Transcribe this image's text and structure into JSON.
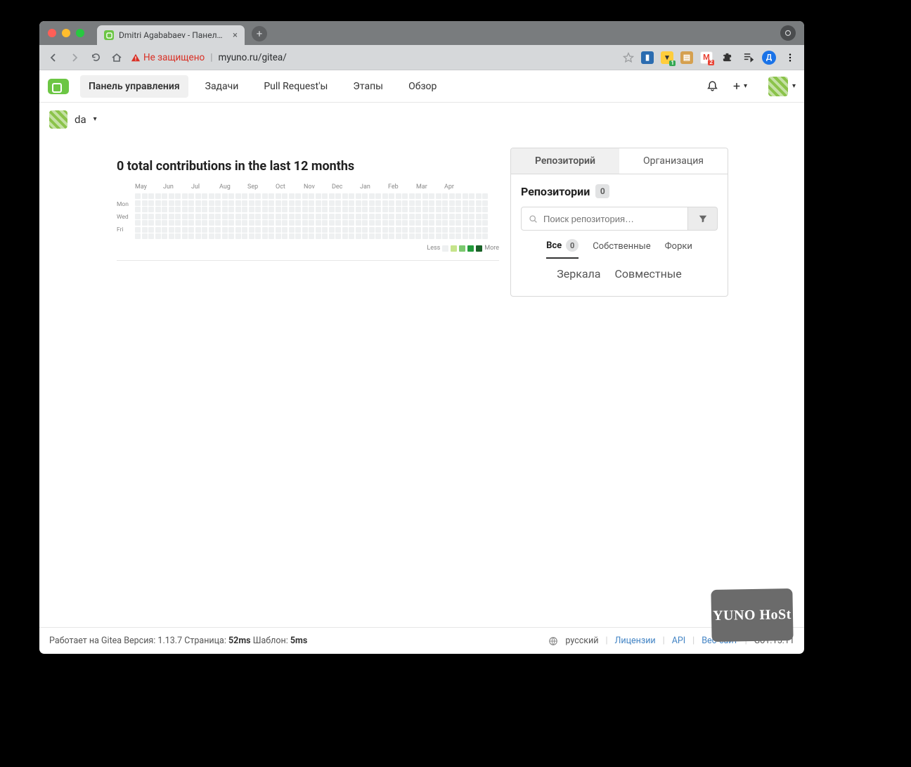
{
  "browser": {
    "tab_title": "Dmitri Agababaev - Панель уп",
    "not_secure_label": "Не защищено",
    "url": "myuno.ru/gitea/",
    "traffic_colors": {
      "close": "#ff5f57",
      "min": "#ffbd2e",
      "max": "#28c840"
    },
    "ext_badges": {
      "green": "1",
      "red": "2"
    },
    "profile_letter": "Д"
  },
  "nav": {
    "tabs": [
      "Панель управления",
      "Задачи",
      "Pull Request'ы",
      "Этапы",
      "Обзор"
    ],
    "active_index": 0
  },
  "context": {
    "username": "da"
  },
  "contributions": {
    "title": "0 total contributions in the last 12 months",
    "months": [
      "May",
      "Jun",
      "Jul",
      "Aug",
      "Sep",
      "Oct",
      "Nov",
      "Dec",
      "Jan",
      "Feb",
      "Mar",
      "Apr"
    ],
    "days": [
      "Mon",
      "Wed",
      "Fri"
    ],
    "legend": {
      "less": "Less",
      "more": "More",
      "colors": [
        "#eef0f1",
        "#c6e48b",
        "#7bc96f",
        "#239a3b",
        "#196127"
      ]
    }
  },
  "sidebar": {
    "panel_tabs": {
      "repo": "Репозиторий",
      "org": "Организация",
      "active": "repo"
    },
    "repos_title": "Репозитории",
    "repos_count": "0",
    "search_placeholder": "Поиск репозитория…",
    "filter_tabs": {
      "all": "Все",
      "all_count": "0",
      "sources": "Собственные",
      "forks": "Форки",
      "mirrors": "Зеркала",
      "collab": "Совместные",
      "active": "all"
    }
  },
  "footer": {
    "powered_prefix": "Работает на Gitea",
    "version_label": "Версия:",
    "version": "1.13.7",
    "page_label": "Страница:",
    "page_time": "52ms",
    "template_label": "Шаблон:",
    "template_time": "5ms",
    "language": "русский",
    "links": {
      "licenses": "Лицензии",
      "api": "API",
      "website": "Веб-сайт"
    },
    "go_version": "Go1.15.11"
  },
  "overlay": {
    "yunohost": "YUNO HoSt"
  }
}
